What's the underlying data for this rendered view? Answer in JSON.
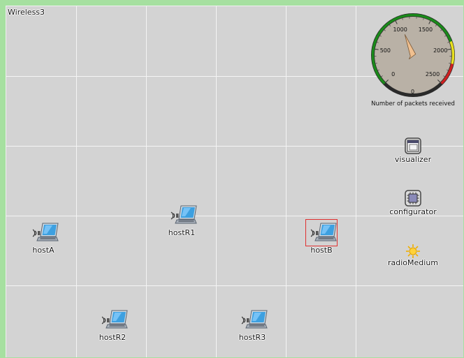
{
  "network": {
    "name": "Wireless3"
  },
  "hosts": [
    {
      "id": "hostA",
      "label": "hostA",
      "selected": false
    },
    {
      "id": "hostR1",
      "label": "hostR1",
      "selected": false
    },
    {
      "id": "hostR2",
      "label": "hostR2",
      "selected": false
    },
    {
      "id": "hostR3",
      "label": "hostR3",
      "selected": false
    },
    {
      "id": "hostB",
      "label": "hostB",
      "selected": true
    }
  ],
  "modules": {
    "visualizer": {
      "label": "visualizer",
      "icon": "window-icon"
    },
    "configurator": {
      "label": "configurator",
      "icon": "chip-icon"
    },
    "radioMedium": {
      "label": "radioMedium",
      "icon": "sun-icon"
    }
  },
  "gauge": {
    "caption": "Number of packets received",
    "value": 0,
    "min": 0,
    "max": 2500,
    "tick_labels": [
      "0",
      "500",
      "1000",
      "1500",
      "2000",
      "2500"
    ],
    "center_label": "0",
    "colors": {
      "green": "#1a8a1a",
      "yellow": "#e8e020",
      "red": "#d02020",
      "face": "#b9b1a6",
      "needle": "#f0c090"
    }
  },
  "colors": {
    "background": "#d3d3d3",
    "frame": "#a6e0a0",
    "grid": "#f4f4f4",
    "selection": "#e03030"
  }
}
